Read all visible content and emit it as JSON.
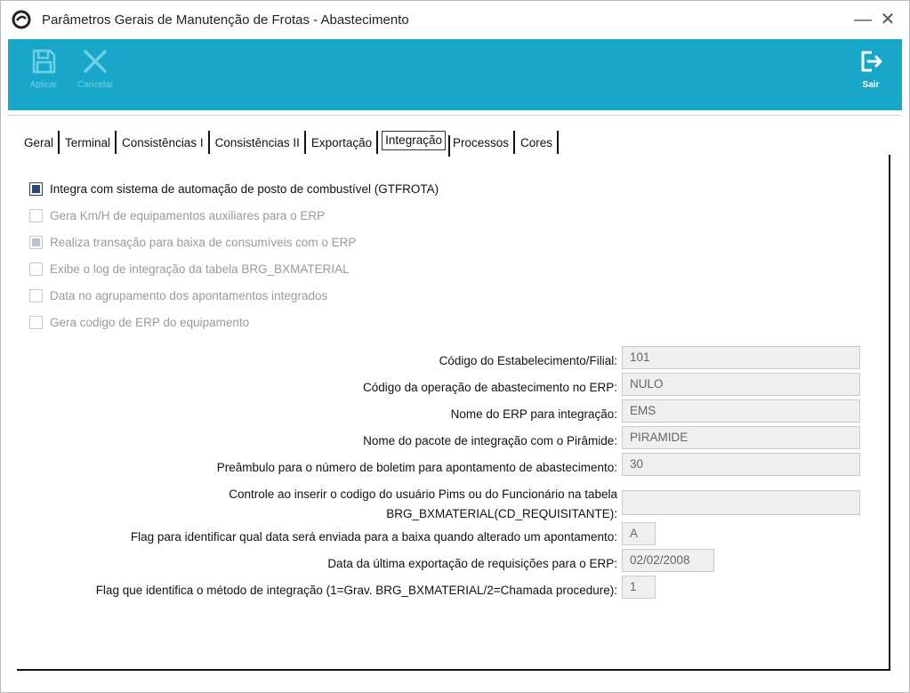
{
  "window": {
    "title": "Parâmetros Gerais de Manutenção de Frotas - Abastecimento",
    "minimize_glyph": "—",
    "close_glyph": "✕",
    "logo_icon": "app-logo-icon"
  },
  "toolbar": {
    "background": "#18a6c9",
    "apply": {
      "label": "Aplicar",
      "icon": "save-icon",
      "enabled": false
    },
    "cancel": {
      "label": "Cancelar",
      "icon": "x-icon",
      "enabled": false
    },
    "exit": {
      "label": "Sair",
      "icon": "exit-icon",
      "enabled": true
    }
  },
  "tabs": [
    {
      "label": "Geral"
    },
    {
      "label": "Terminal"
    },
    {
      "label": "Consistências I"
    },
    {
      "label": "Consistências II"
    },
    {
      "label": "Exportação"
    },
    {
      "label": "Integração",
      "active": true
    },
    {
      "label": "Processos"
    },
    {
      "label": "Cores"
    }
  ],
  "checkboxes": [
    {
      "label": "Integra com sistema de automação de posto de combustível (GTFROTA)",
      "checked": true,
      "enabled": true
    },
    {
      "label": "Gera Km/H de equipamentos auxiliares  para o ERP",
      "checked": false,
      "enabled": false
    },
    {
      "label": "Realiza transação para baixa de consumíveis com o ERP",
      "checked": true,
      "enabled": false
    },
    {
      "label": "Exibe o log de integração da tabela BRG_BXMATERIAL",
      "checked": false,
      "enabled": false
    },
    {
      "label": "Data no agrupamento dos apontamentos integrados",
      "checked": false,
      "enabled": false
    },
    {
      "label": "Gera codigo de ERP do equipamento",
      "checked": false,
      "enabled": false
    }
  ],
  "fields": [
    {
      "label": "Código do Estabelecimento/Filial:",
      "value": "101"
    },
    {
      "label": "Código da operação de abastecimento no ERP:",
      "value": "NULO"
    },
    {
      "label": "Nome do ERP para integração:",
      "value": "EMS"
    },
    {
      "label": "Nome do pacote de integração com o Pirâmide:",
      "value": "PIRAMIDE"
    },
    {
      "label": "Preâmbulo para o número de boletim para apontamento de abastecimento:",
      "value": "30"
    },
    {
      "label_line1": "Controle ao inserir o codigo do usuário Pims ou do Funcionário na tabela",
      "label_line2": "BRG_BXMATERIAL(CD_REQUISITANTE):",
      "value": ""
    },
    {
      "label": "Flag para identificar qual data será enviada para a baixa quando alterado um apontamento:",
      "value": "A"
    },
    {
      "label": "Data da última exportação de requisições para o ERP:",
      "value": "02/02/2008"
    },
    {
      "label": "Flag que identifica o método de integração (1=Grav. BRG_BXMATERIAL/2=Chamada procedure):",
      "value": "1"
    }
  ]
}
